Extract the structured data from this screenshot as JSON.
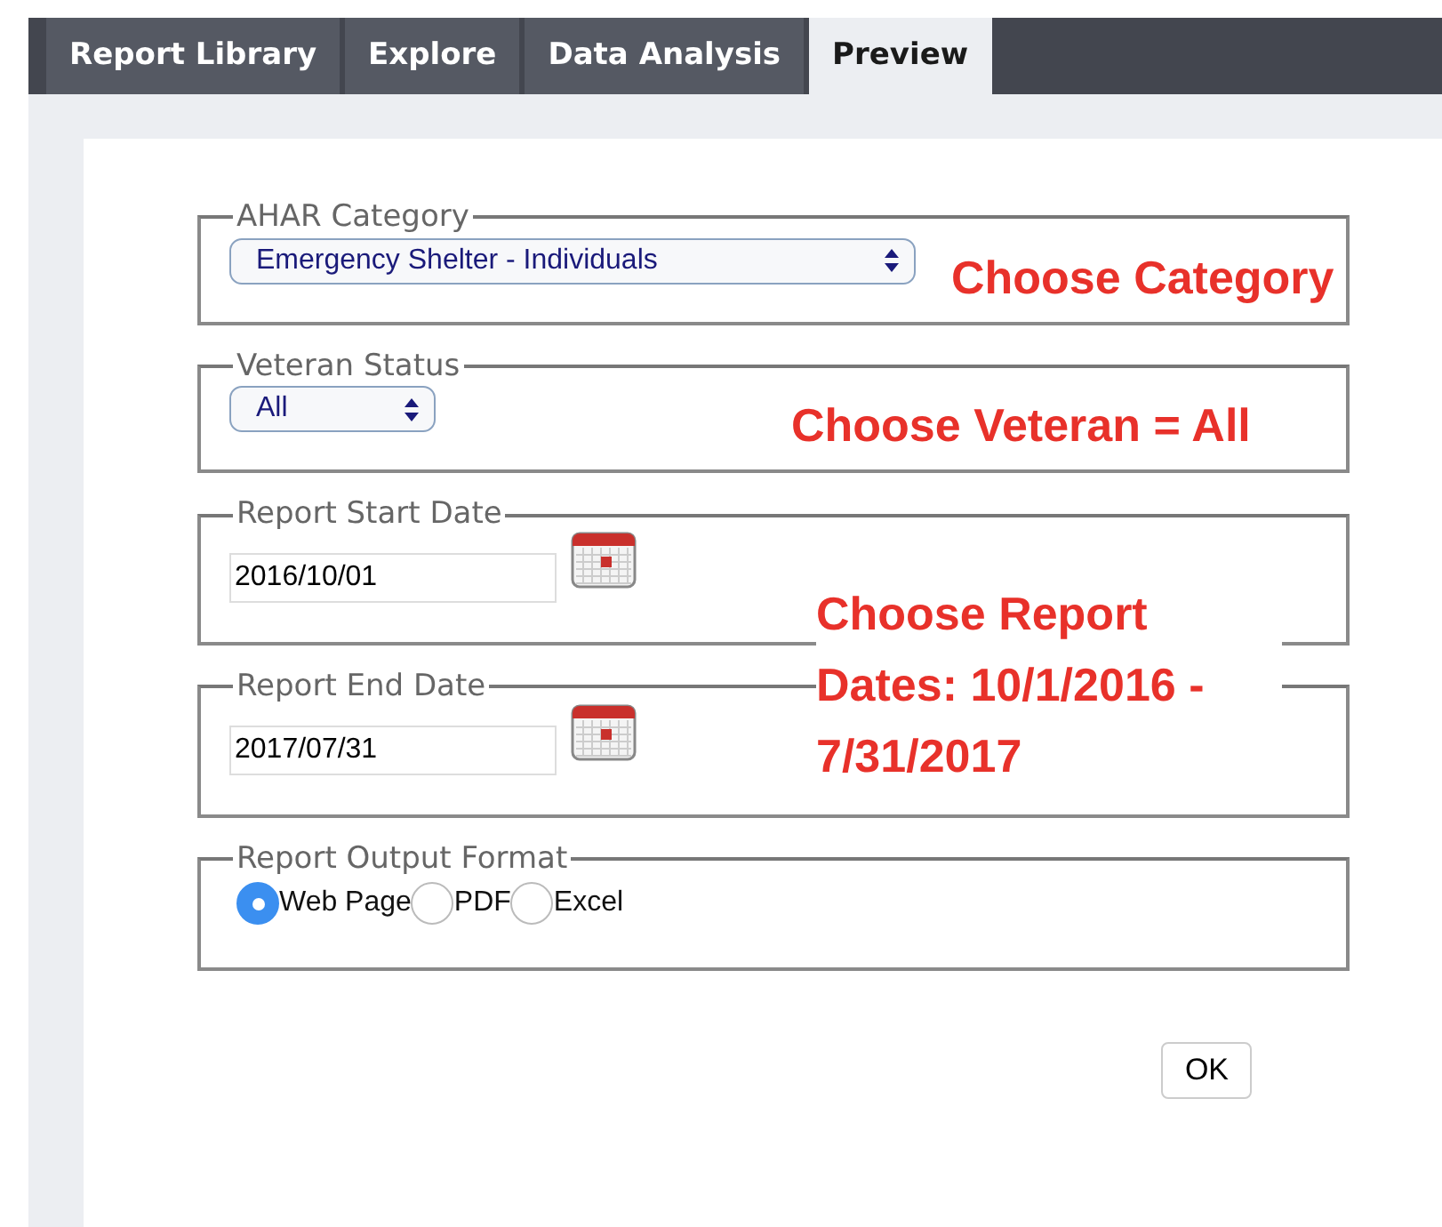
{
  "tabs": [
    {
      "label": "Report Library",
      "selected": false
    },
    {
      "label": "Explore",
      "selected": false
    },
    {
      "label": "Data Analysis",
      "selected": false
    },
    {
      "label": "Preview",
      "selected": true
    }
  ],
  "form": {
    "fields": [
      {
        "kind": "select",
        "legend": "AHAR Category",
        "value": "Emergency Shelter - Individuals"
      },
      {
        "kind": "select",
        "legend": "Veteran Status",
        "value": "All"
      },
      {
        "kind": "date",
        "legend": "Report Start Date",
        "value": "2016/10/01"
      },
      {
        "kind": "date",
        "legend": "Report End Date",
        "value": "2017/07/31"
      },
      {
        "kind": "radio",
        "legend": "Report Output Format",
        "options": [
          {
            "label": "Web Page",
            "selected": true
          },
          {
            "label": "PDF",
            "selected": false
          },
          {
            "label": "Excel",
            "selected": false
          }
        ]
      }
    ],
    "ok_button": "OK"
  },
  "annotations": [
    "Choose Category",
    "Choose Veteran = All",
    "Choose Report Dates: 10/1/2016 - 7/31/2017"
  ]
}
